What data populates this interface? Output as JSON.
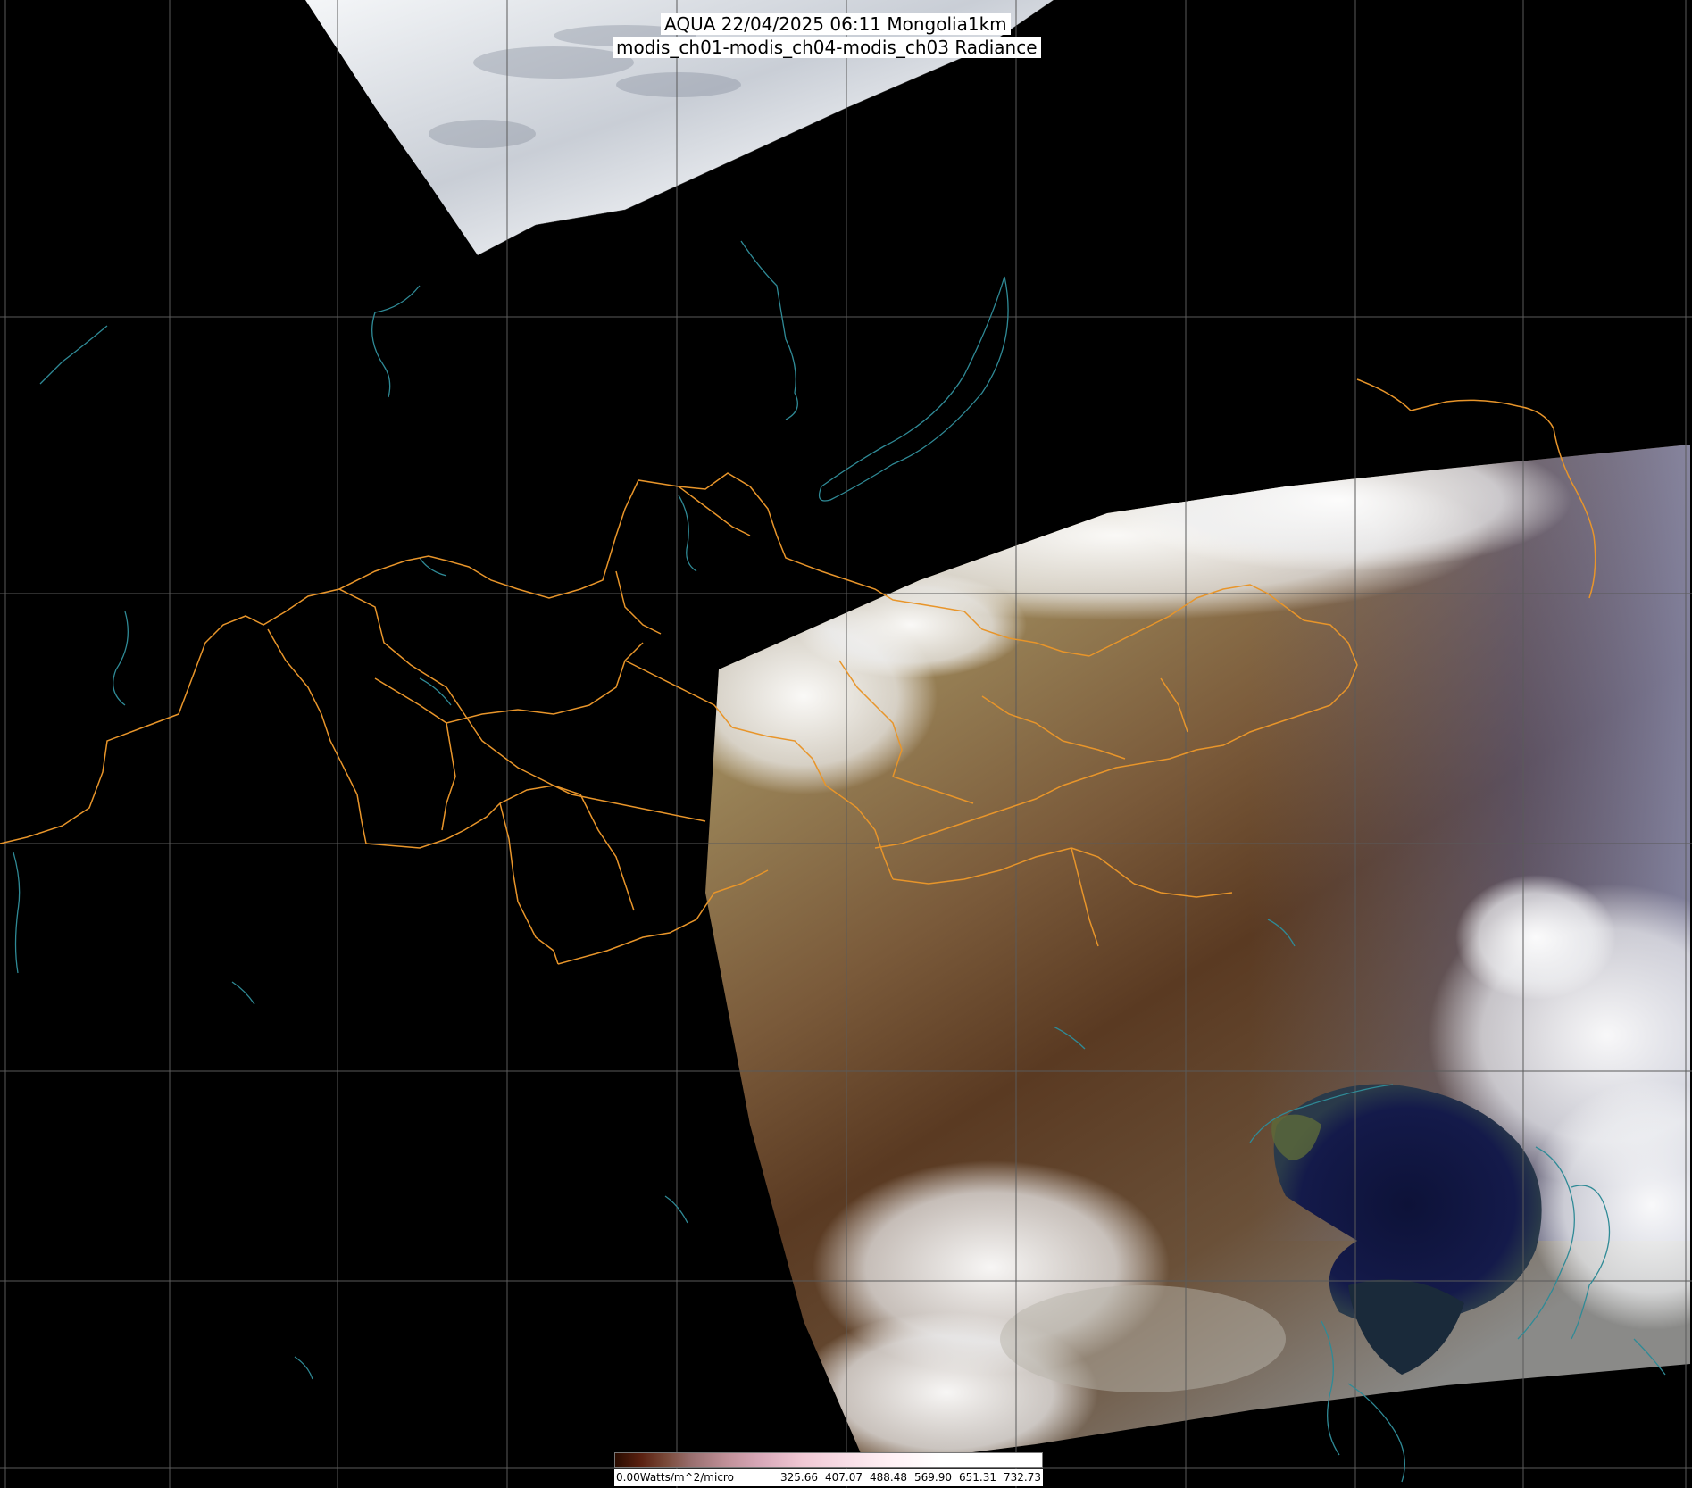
{
  "title": {
    "line1": "AQUA 22/04/2025 06:11 Mongolia1km",
    "line2": "modis_ch01-modis_ch04-modis_ch03 Radiance"
  },
  "colorbar": {
    "labels": [
      "0.00Watts/m^2/micro",
      "325.66",
      "407.07",
      "488.48",
      "569.90",
      "651.31",
      "732.73"
    ]
  },
  "colors": {
    "background": "#000000",
    "grid": "#5a5a5a",
    "province_borders": "#e8952a",
    "coastlines_lakes": "#2f8a96",
    "title_background": "#ffffff"
  },
  "layers": [
    "satellite-swath-north",
    "satellite-swath-main",
    "lat-lon-grid",
    "coastlines-lakes",
    "province-borders",
    "title",
    "colorbar"
  ]
}
